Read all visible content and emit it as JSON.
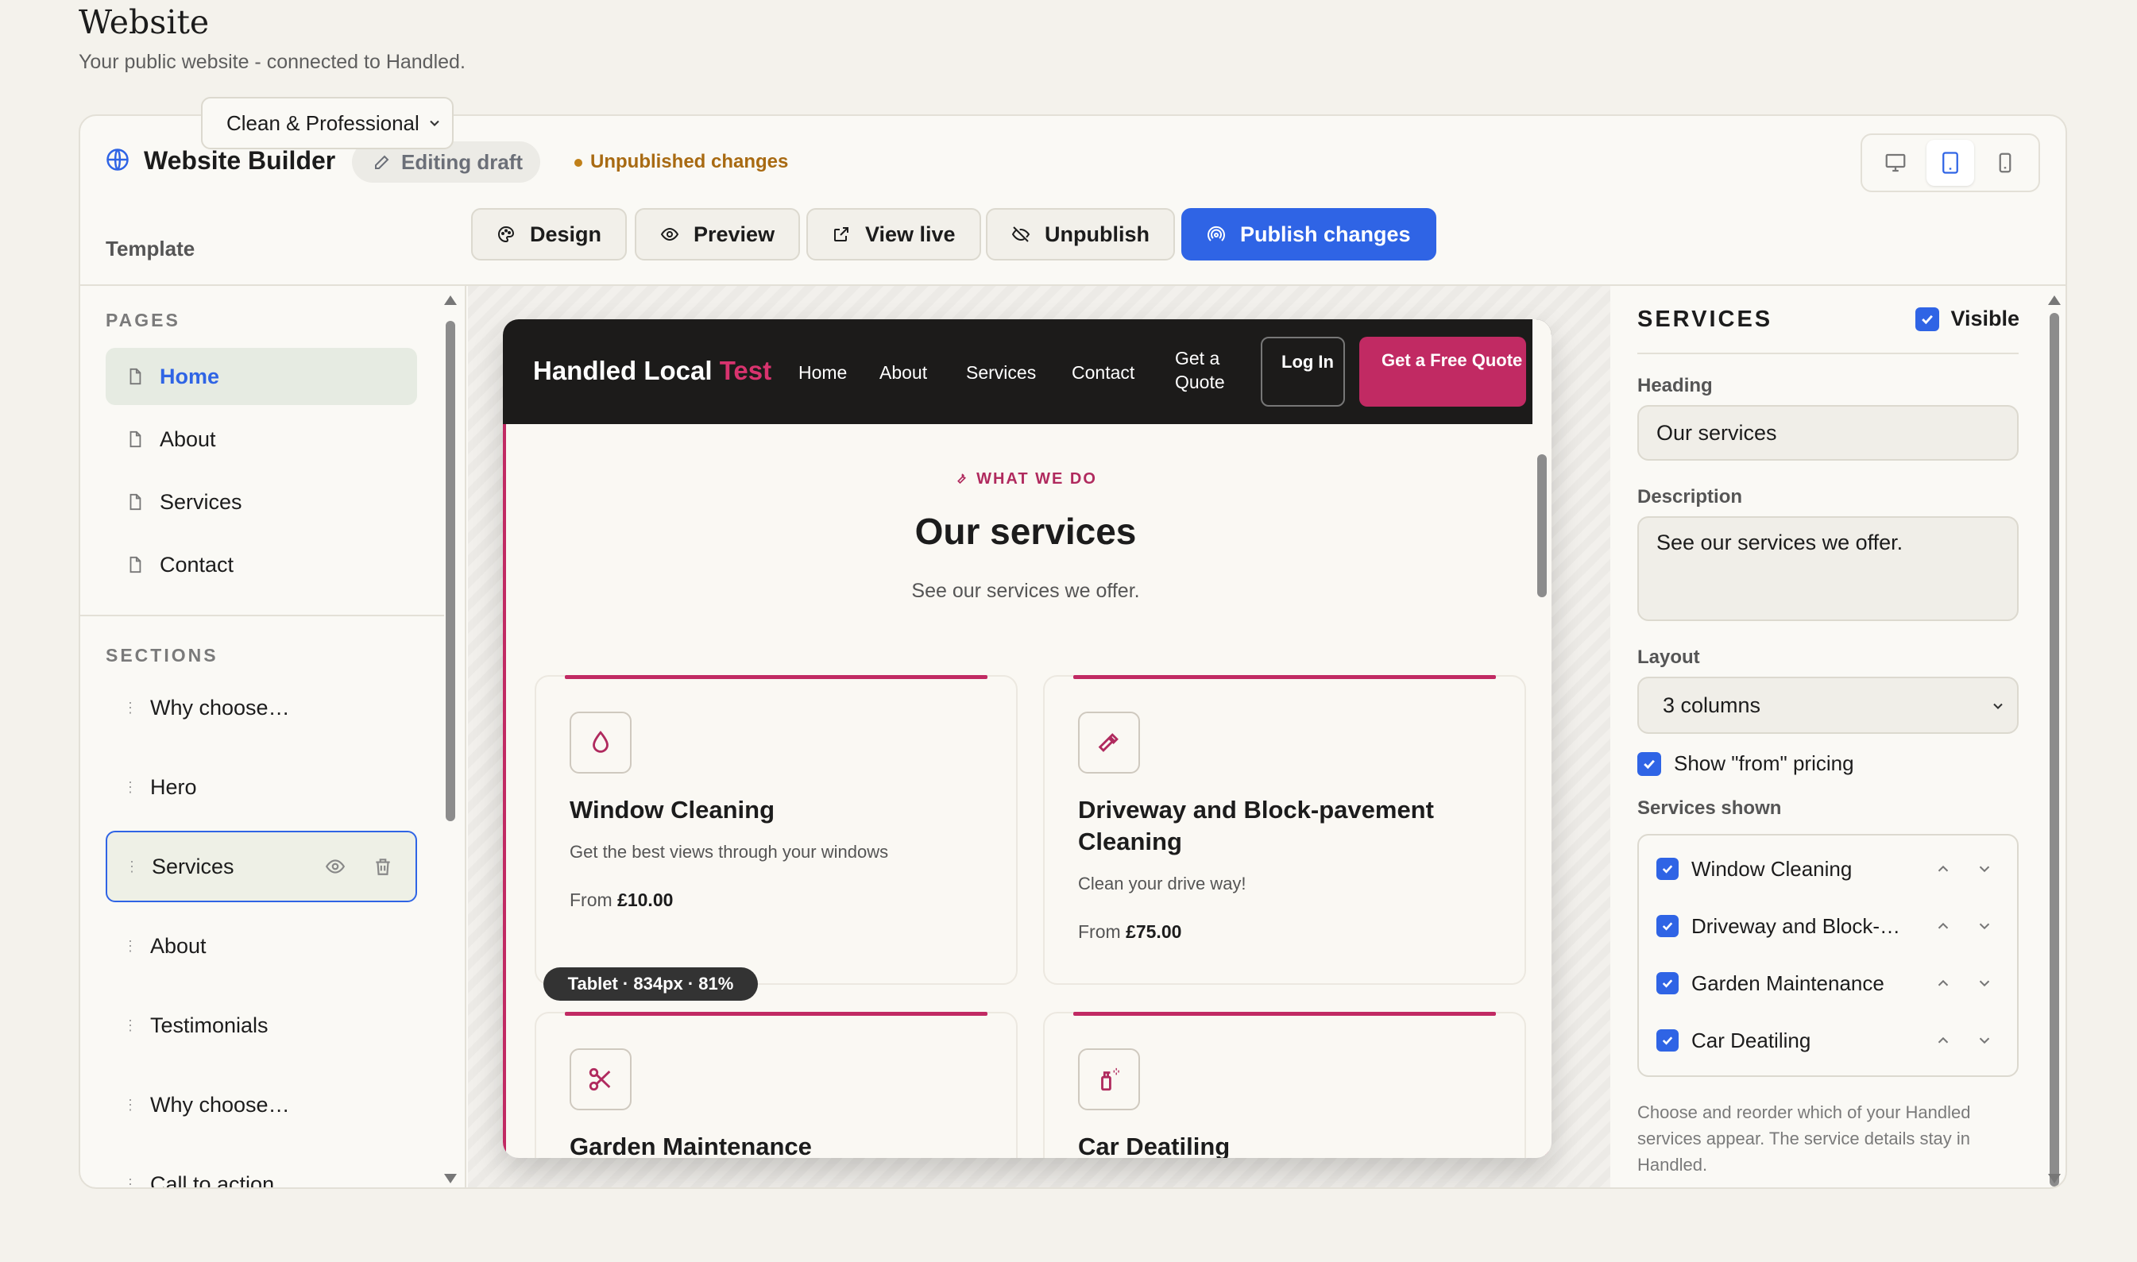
{
  "page": {
    "title": "Website",
    "subtitle": "Your public website - connected to Handled."
  },
  "builder": {
    "title": "Website Builder",
    "draft_label": "Editing draft",
    "status": "Unpublished changes",
    "devices": [
      "desktop-icon",
      "tablet-icon",
      "mobile-icon"
    ],
    "active_device": "tablet"
  },
  "toolbar": {
    "template_label": "Template",
    "template_value": "Clean & Professional",
    "design": "Design",
    "preview": "Preview",
    "view_live": "View live",
    "unpublish": "Unpublish",
    "publish": "Publish changes"
  },
  "sidebar": {
    "pages_heading": "PAGES",
    "pages": [
      {
        "label": "Home",
        "active": true
      },
      {
        "label": "About"
      },
      {
        "label": "Services"
      },
      {
        "label": "Contact"
      }
    ],
    "sections_heading": "SECTIONS",
    "sections": [
      {
        "label": "Why choose…"
      },
      {
        "label": "Hero"
      },
      {
        "label": "Services",
        "selected": true
      },
      {
        "label": "About"
      },
      {
        "label": "Testimonials"
      },
      {
        "label": "Why choose…"
      },
      {
        "label": "Call to action"
      }
    ]
  },
  "site": {
    "brand_main": "Handled Local",
    "brand_accent": "Test",
    "nav": [
      "Home",
      "About",
      "Services",
      "Contact"
    ],
    "nav_quote": "Get a Quote",
    "login": "Log In",
    "cta": "Get a Free Quote",
    "eyebrow": "WHAT WE DO",
    "heading": "Our services",
    "description": "See our services we offer.",
    "cards": [
      {
        "title": "Window Cleaning",
        "text": "Get the best views through your windows",
        "from": "From",
        "price": "£10.00",
        "icon": "droplet-icon"
      },
      {
        "title": "Driveway and Block-pavement Cleaning",
        "text": "Clean your drive way!",
        "from": "From",
        "price": "£75.00",
        "icon": "hammer-icon"
      },
      {
        "title": "Garden Maintenance",
        "icon": "scissors-icon"
      },
      {
        "title": "Car Deatiling",
        "icon": "spray-bottle-icon"
      }
    ]
  },
  "viewport_badge": "Tablet · 834px · 81%",
  "panel": {
    "title": "SERVICES",
    "visible_label": "Visible",
    "heading_label": "Heading",
    "heading_value": "Our services",
    "description_label": "Description",
    "description_value": "See our services we offer.",
    "layout_label": "Layout",
    "layout_value": "3 columns",
    "pricing_label": "Show \"from\" pricing",
    "services_label": "Services shown",
    "services": [
      "Window Cleaning",
      "Driveway and Block-pavement Cleaning",
      "Garden Maintenance",
      "Car Deatiling"
    ],
    "hint": "Choose and reorder which of your Handled services appear. The service details stay in Handled."
  },
  "colors": {
    "accent": "#2f64e5",
    "brand": "#c12a63",
    "warning": "#a86a12"
  }
}
